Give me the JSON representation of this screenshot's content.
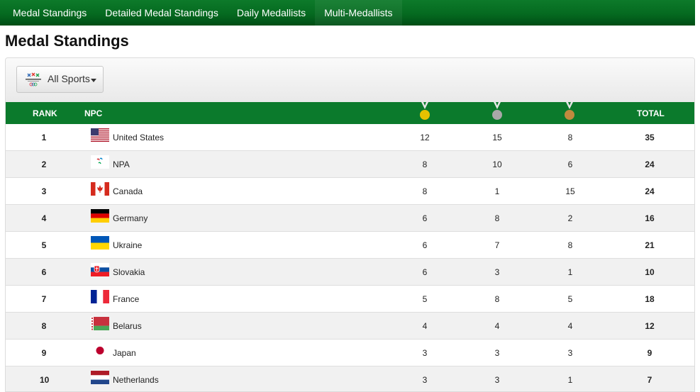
{
  "nav": {
    "items": [
      "Medal Standings",
      "Detailed Medal Standings",
      "Daily Medallists",
      "Multi-Medallists"
    ]
  },
  "page_title": "Medal Standings",
  "filter": {
    "sport_label": "All Sports",
    "logo_icon": "pyeongchang-2018-paralympics-logo-icon"
  },
  "table": {
    "headers": {
      "rank": "RANK",
      "npc": "NPC",
      "total": "TOTAL"
    },
    "medal_icons": [
      "gold-medal-icon",
      "silver-medal-icon",
      "bronze-medal-icon"
    ],
    "rows": [
      {
        "rank": "1",
        "country": "United States",
        "flag": "flag-usa-icon",
        "gold": "12",
        "silver": "15",
        "bronze": "8",
        "total": "35"
      },
      {
        "rank": "2",
        "country": "NPA",
        "flag": "paralympic-agitos-icon",
        "gold": "8",
        "silver": "10",
        "bronze": "6",
        "total": "24"
      },
      {
        "rank": "3",
        "country": "Canada",
        "flag": "flag-canada-icon",
        "gold": "8",
        "silver": "1",
        "bronze": "15",
        "total": "24"
      },
      {
        "rank": "4",
        "country": "Germany",
        "flag": "flag-germany-icon",
        "gold": "6",
        "silver": "8",
        "bronze": "2",
        "total": "16"
      },
      {
        "rank": "5",
        "country": "Ukraine",
        "flag": "flag-ukraine-icon",
        "gold": "6",
        "silver": "7",
        "bronze": "8",
        "total": "21"
      },
      {
        "rank": "6",
        "country": "Slovakia",
        "flag": "flag-slovakia-icon",
        "gold": "6",
        "silver": "3",
        "bronze": "1",
        "total": "10"
      },
      {
        "rank": "7",
        "country": "France",
        "flag": "flag-france-icon",
        "gold": "5",
        "silver": "8",
        "bronze": "5",
        "total": "18"
      },
      {
        "rank": "8",
        "country": "Belarus",
        "flag": "flag-belarus-icon",
        "gold": "4",
        "silver": "4",
        "bronze": "4",
        "total": "12"
      },
      {
        "rank": "9",
        "country": "Japan",
        "flag": "flag-japan-icon",
        "gold": "3",
        "silver": "3",
        "bronze": "3",
        "total": "9"
      },
      {
        "rank": "10",
        "country": "Netherlands",
        "flag": "flag-netherlands-icon",
        "gold": "3",
        "silver": "3",
        "bronze": "1",
        "total": "7"
      }
    ]
  },
  "colors": {
    "nav_green": "#056a20",
    "header_green": "#0b7a2c",
    "gold": "#e5c100",
    "silver": "#a8a8a8",
    "bronze": "#c08a3e"
  }
}
